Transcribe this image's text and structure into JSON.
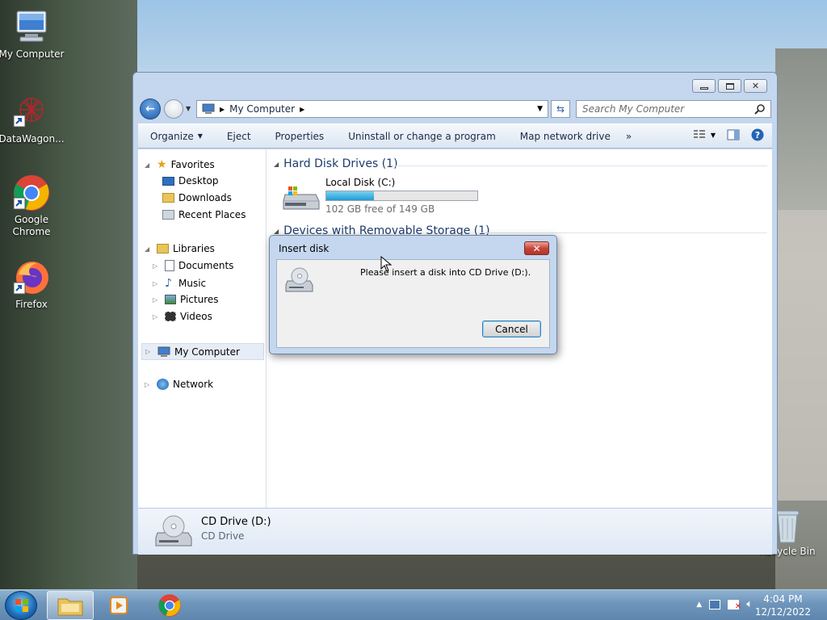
{
  "desktop": {
    "icons": [
      {
        "label": "My Computer",
        "icon": "computer-icon"
      },
      {
        "label": "DataWagon...",
        "icon": "datawagon-icon"
      },
      {
        "label": "Google Chrome",
        "icon": "chrome-icon"
      },
      {
        "label": "Firefox",
        "icon": "firefox-icon"
      },
      {
        "label": "Recycle Bin",
        "icon": "recycle-bin-icon"
      }
    ]
  },
  "window": {
    "address": {
      "path": "My Computer"
    },
    "search": {
      "placeholder": "Search My Computer"
    },
    "toolbar": {
      "organize": "Organize",
      "eject": "Eject",
      "properties": "Properties",
      "uninstall": "Uninstall or change a program",
      "map_drive": "Map network drive",
      "more": "»"
    },
    "nav": {
      "favorites": "Favorites",
      "desktop": "Desktop",
      "downloads": "Downloads",
      "recent": "Recent Places",
      "libraries": "Libraries",
      "documents": "Documents",
      "music": "Music",
      "pictures": "Pictures",
      "videos": "Videos",
      "computer": "My Computer",
      "network": "Network"
    },
    "groups": {
      "hdd": "Hard Disk Drives (1)",
      "removable": "Devices with Removable Storage (1)"
    },
    "local_disk": {
      "name": "Local Disk (C:)",
      "free": "102 GB free of 149 GB",
      "used_fraction": 0.315
    },
    "details": {
      "name": "CD Drive (D:)",
      "type": "CD Drive"
    }
  },
  "dialog": {
    "title": "Insert disk",
    "message": "Please insert a disk into CD Drive (D:).",
    "cancel": "Cancel",
    "close": "✕"
  },
  "taskbar": {
    "time": "4:04 PM",
    "date": "12/12/2022"
  },
  "colors": {
    "accent": "#1f5dad",
    "progress": "#27a6d8"
  }
}
